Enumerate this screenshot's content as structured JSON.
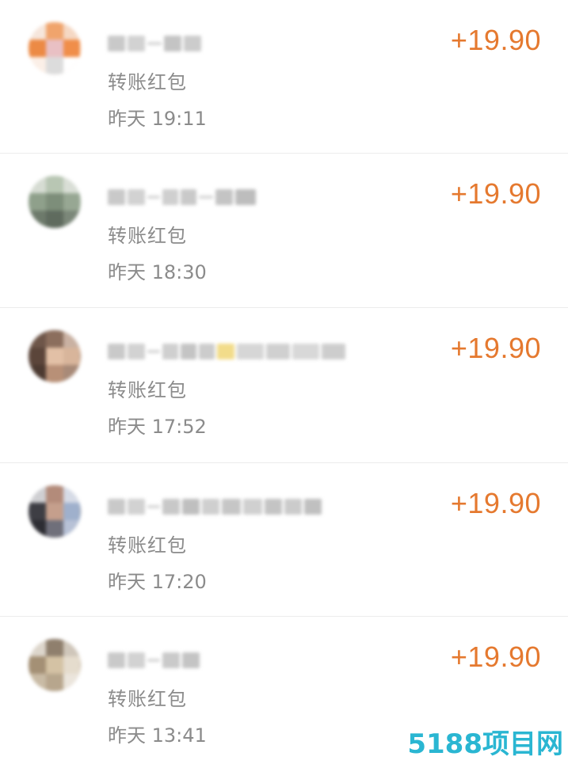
{
  "transactions": [
    {
      "type": "转账红包",
      "time": "昨天 19:11",
      "amount": "+19.90"
    },
    {
      "type": "转账红包",
      "time": "昨天 18:30",
      "amount": "+19.90"
    },
    {
      "type": "转账红包",
      "time": "昨天 17:52",
      "amount": "+19.90"
    },
    {
      "type": "转账红包",
      "time": "昨天 17:20",
      "amount": "+19.90"
    },
    {
      "type": "转账红包",
      "time": "昨天 13:41",
      "amount": "+19.90"
    }
  ],
  "colors": {
    "amount": "#e5792f",
    "secondary_text": "#8b8b8b",
    "watermark": "#19b0cf"
  },
  "watermark": "5188项目网"
}
